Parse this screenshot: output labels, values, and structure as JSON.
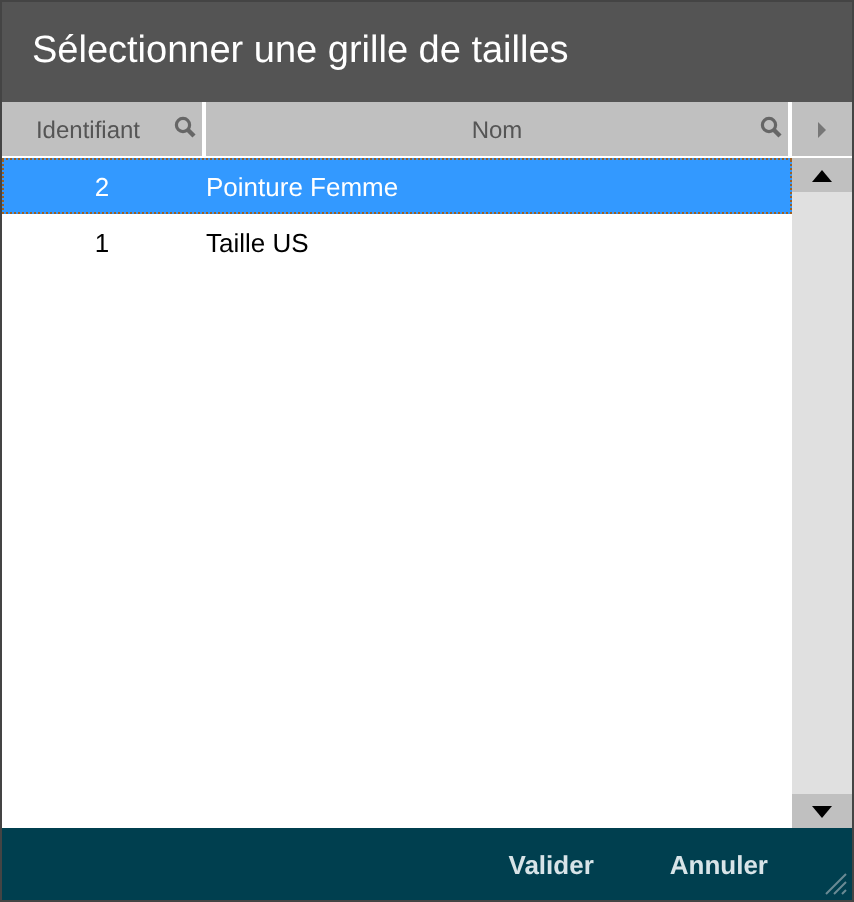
{
  "window": {
    "title": "Sélectionner une grille de tailles"
  },
  "table": {
    "columns": [
      {
        "label": "Identifiant",
        "kind": "id"
      },
      {
        "label": "Nom",
        "kind": "name"
      }
    ],
    "rows": [
      {
        "id": "2",
        "name": "Pointure Femme",
        "selected": true
      },
      {
        "id": "1",
        "name": "Taille US",
        "selected": false
      }
    ]
  },
  "buttons": [
    "Valider",
    "Annuler"
  ]
}
